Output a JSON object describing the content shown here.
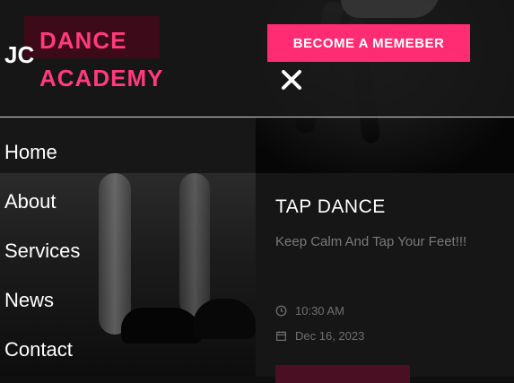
{
  "header": {
    "logo_initials": "JC",
    "logo_text_line1": "DANCE",
    "logo_text_line2": "ACADEMY",
    "cta_label": "BECOME A MEMEBER",
    "close_icon": "close-icon"
  },
  "nav": {
    "items": [
      {
        "label": "Home"
      },
      {
        "label": "About"
      },
      {
        "label": "Services"
      },
      {
        "label": "News"
      },
      {
        "label": "Contact"
      }
    ]
  },
  "card": {
    "title": "TAP DANCE",
    "description": "Keep Calm And Tap Your Feet!!!",
    "time": "10:30 AM",
    "date": "Dec 16, 2023",
    "time_icon": "clock-icon",
    "date_icon": "calendar-icon"
  },
  "colors": {
    "accent": "#ff2c73",
    "logo_text": "#ff3a7d",
    "logo_bg": "#3c0a18"
  }
}
